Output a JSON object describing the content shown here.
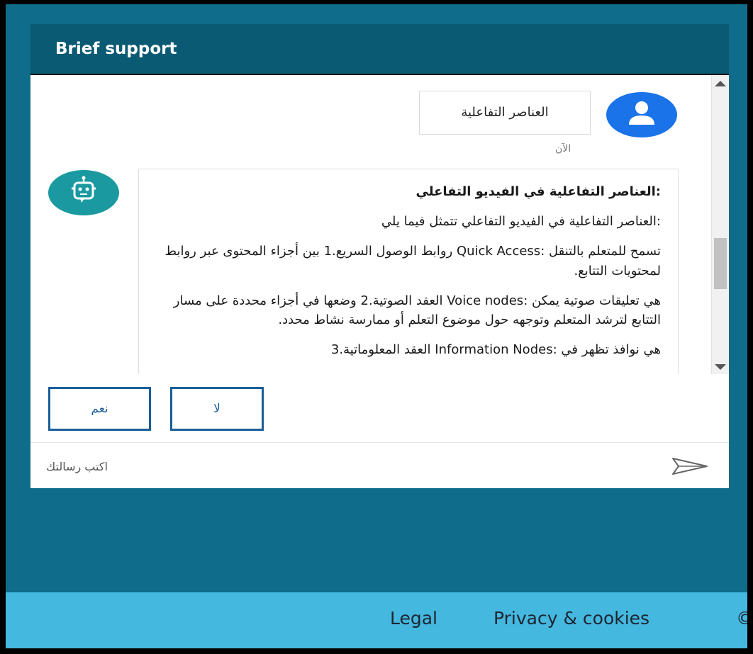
{
  "widget": {
    "title": "Brief support"
  },
  "conversation": {
    "user_message": "العناصر التفاعلية",
    "timestamp": "الآن",
    "bot_message": {
      "title": ":العناصر التفاعلية في الفيديو التفاعلي",
      "intro": ":العناصر التفاعلية في الفيديو التفاعلي تتمثل فيما يلي",
      "items": [
        "تسمح للمتعلم بالتنقل :Quick Access روابط الوصول السريع.1 بين أجزاء المحتوى عبر روابط لمحتويات التتابع.",
        "هي تعليقات صوتية يمكن :Voice nodes العقد الصوتية.2 وضعها في أجزاء محددة على مسار التتابع لترشد المتعلم وتوجهه حول موضوع التعلم أو ممارسة نشاط محدد.",
        "هي نوافذ تظهر في :Information Nodes العقد المعلوماتية.3"
      ]
    }
  },
  "quick_replies": {
    "yes": "نعم",
    "no": "لا"
  },
  "composer": {
    "placeholder": "اكتب رسالتك"
  },
  "footer": {
    "legal": "Legal",
    "privacy": "Privacy & cookies",
    "copyright": "©"
  },
  "colors": {
    "page_bg": "#0f6c8a",
    "header_bg": "#0a5a73",
    "footer_bg": "#45b8e0",
    "user_avatar": "#1a73e8",
    "bot_avatar": "#1a9aa0",
    "button_border": "#1a5f99"
  },
  "icons": {
    "user_avatar": "person-icon",
    "bot_avatar": "robot-icon",
    "send": "send-icon"
  }
}
